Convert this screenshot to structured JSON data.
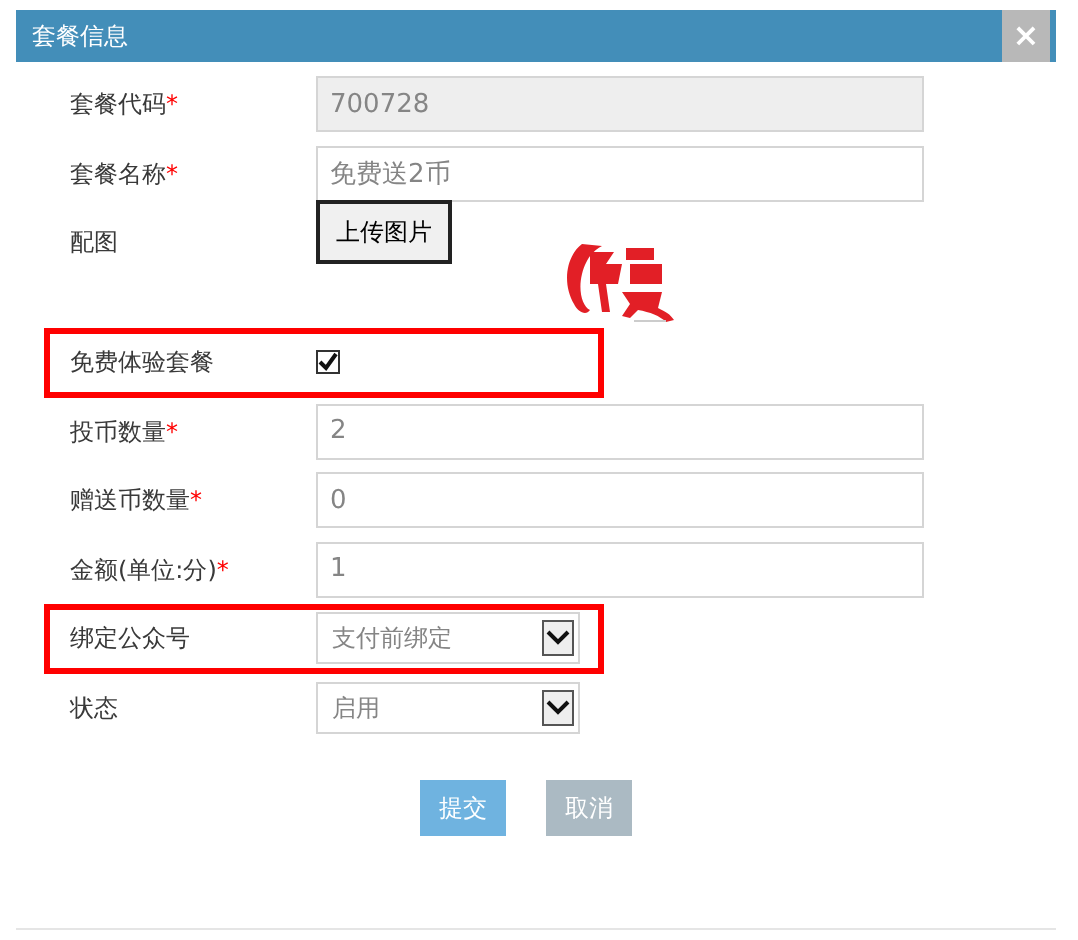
{
  "dialog": {
    "title": "套餐信息",
    "close": "×"
  },
  "fields": [
    {
      "kind": "text",
      "label": "套餐代码",
      "required": "*",
      "value": "700728",
      "readonly": true,
      "highlighted": false
    },
    {
      "kind": "text",
      "label": "套餐名称",
      "required": "*",
      "value": "免费送2币",
      "readonly": false,
      "highlighted": false
    },
    {
      "kind": "upload",
      "label": "配图",
      "button": "上传图片",
      "highlighted": false
    },
    {
      "kind": "checkbox",
      "label": "免费体验套餐",
      "checked": true,
      "highlighted": true
    },
    {
      "kind": "text",
      "label": "投币数量",
      "required": "*",
      "value": "2",
      "readonly": false,
      "highlighted": false
    },
    {
      "kind": "text",
      "label": "赠送币数量",
      "required": "*",
      "value": "0",
      "readonly": false,
      "highlighted": false
    },
    {
      "kind": "text",
      "label": "金额(单位:分)",
      "required": "*",
      "value": "1",
      "readonly": false,
      "highlighted": false
    },
    {
      "kind": "select",
      "label": "绑定公众号",
      "value": "支付前绑定",
      "highlighted": true
    },
    {
      "kind": "select",
      "label": "状态",
      "value": "启用",
      "highlighted": false
    }
  ],
  "buttons": [
    {
      "label": "提交",
      "kind": "primary"
    },
    {
      "label": "取消",
      "kind": "secondary"
    }
  ]
}
